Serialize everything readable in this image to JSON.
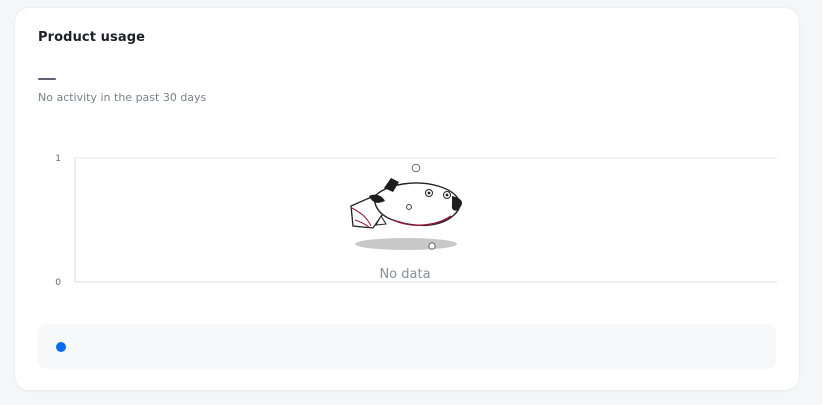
{
  "card": {
    "title": "Product usage",
    "subtitle": "No activity in the past 30 days"
  },
  "chart_data": {
    "type": "line",
    "yticks": [
      "1",
      "0"
    ],
    "ylim": [
      0,
      1
    ],
    "series": [],
    "empty_label": "No data",
    "legend_color": "#0a6cf0"
  },
  "colors": {
    "accent": "#0a6cf0"
  },
  "illustration": "empty-state-fish-icon"
}
